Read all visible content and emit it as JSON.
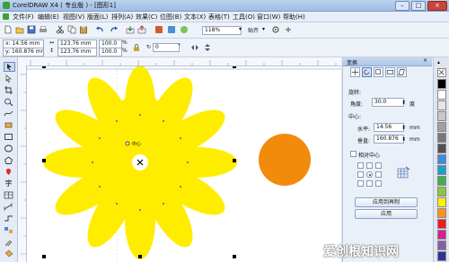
{
  "titlebar": {
    "title": "CorelDRAW X4 ( 专业版 ) - [图形1]",
    "minimize": "–",
    "restore": "□",
    "close": "×"
  },
  "menu": [
    "文件(F)",
    "编辑(E)",
    "视图(V)",
    "版面(L)",
    "排列(A)",
    "效果(C)",
    "位图(B)",
    "文本(X)",
    "表格(T)",
    "工具(O)",
    "窗口(W)",
    "帮助(H)"
  ],
  "toolbar": {
    "zoom_value": "118%",
    "snap_label": "贴齐"
  },
  "propbar": {
    "x": "x: 14.56 mm",
    "y": "y: 160.876 mm",
    "width": "123.76 mm",
    "height": "123.76 mm",
    "scale_x": "100.0",
    "scale_y": "100.0",
    "percent": "%",
    "angle": "0",
    "angle_unit": "°"
  },
  "canvas": {
    "flower_color": "#ffed00",
    "circle_color": "#f28a0c",
    "node_label": "中心"
  },
  "docker": {
    "title": "变换",
    "rotation_label": "旋转:",
    "angle_label": "角度:",
    "angle_value": "30.0",
    "degree_unit": "度",
    "center_label": "中心:",
    "h_label": "水平:",
    "h_value": "14.56",
    "v_label": "垂直:",
    "v_value": "160.876",
    "unit": "mm",
    "relative_center": "相对中心",
    "apply_copy": "应用到再制",
    "apply": "应用"
  },
  "palette": [
    "#000000",
    "#ffffff",
    "#e6e6e6",
    "#c8c8c8",
    "#a0a0a0",
    "#787878",
    "#505050",
    "#3c8be0",
    "#17a3c9",
    "#3fb14a",
    "#8dc63f",
    "#fff200",
    "#f7941d",
    "#ed1c24",
    "#d6208b",
    "#8b5ba8",
    "#2e3192"
  ],
  "watermark": "爱创根知识网"
}
